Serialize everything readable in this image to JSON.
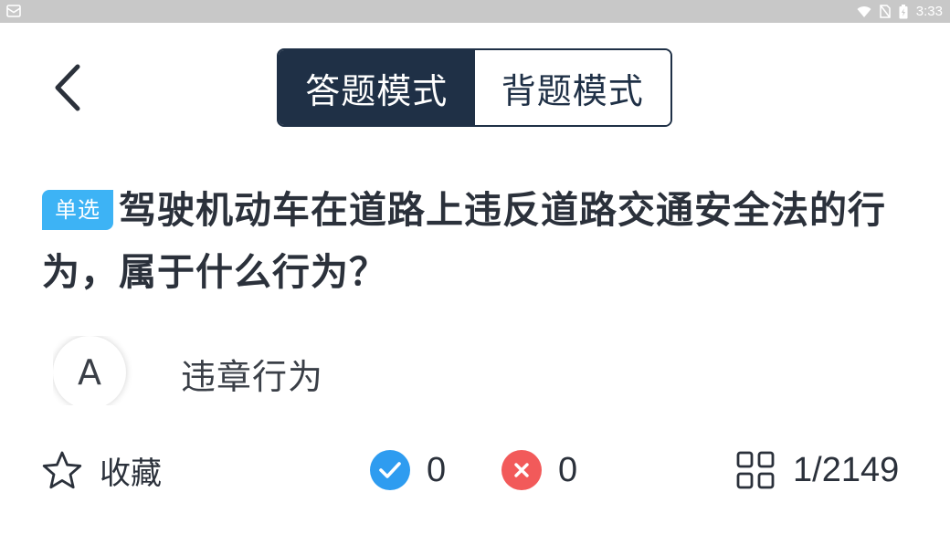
{
  "status_bar": {
    "time": "3:33"
  },
  "header": {
    "back_icon": "chevron-left-icon",
    "modes": [
      {
        "label": "答题模式",
        "active": true
      },
      {
        "label": "背题模式",
        "active": false
      }
    ]
  },
  "question": {
    "type_badge": "单选",
    "text": "驾驶机动车在道路上违反道路交通安全法的行为，属于什么行为？"
  },
  "options": [
    {
      "letter": "A",
      "text": "违章行为"
    }
  ],
  "bottom_bar": {
    "favorite_label": "收藏",
    "correct_count": "0",
    "wrong_count": "0",
    "progress": "1/2149"
  },
  "colors": {
    "navy": "#1f3046",
    "badge_blue": "#3db3f5",
    "correct_blue": "#2e9cf0",
    "wrong_red": "#f25a5a",
    "status_bar_gray": "#c8c8c8"
  }
}
